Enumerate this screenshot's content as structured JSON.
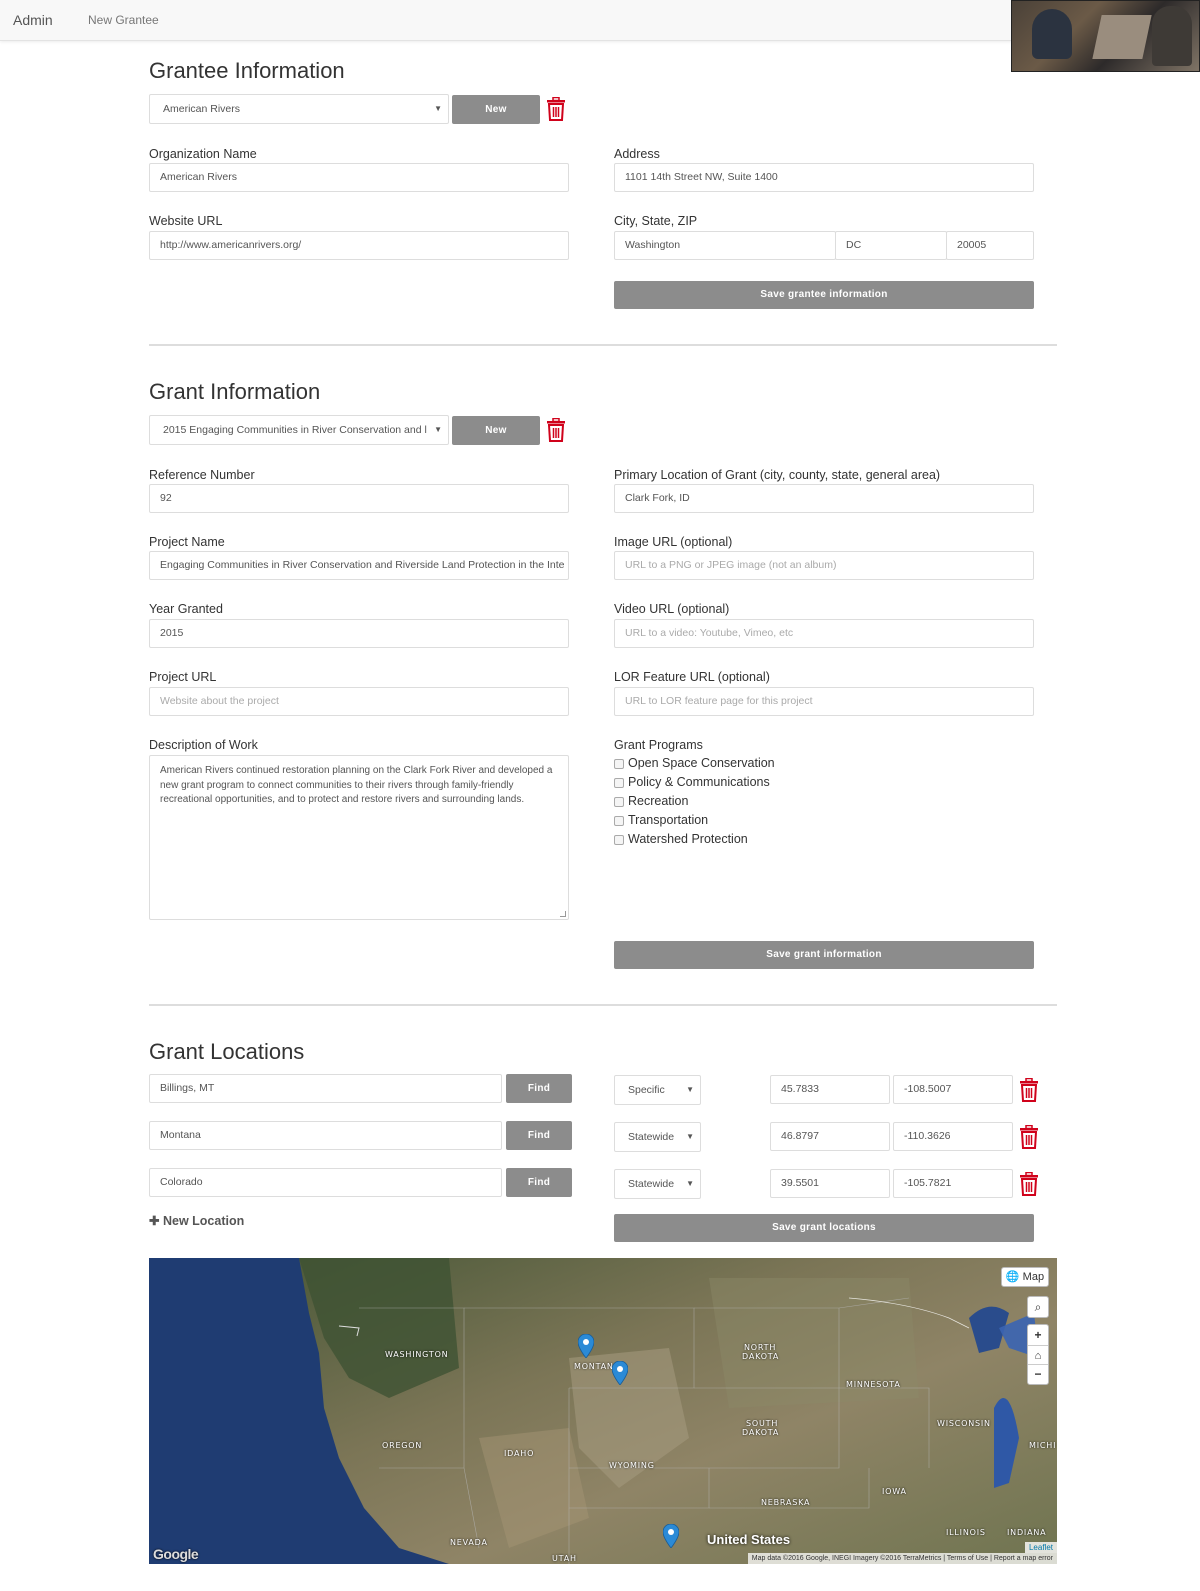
{
  "nav": {
    "brand": "Admin",
    "link": "New Grantee"
  },
  "grantee": {
    "heading": "Grantee Information",
    "select_value": "American Rivers",
    "new_label": "New",
    "org_label": "Organization Name",
    "org_value": "American Rivers",
    "address_label": "Address",
    "address_value": "1101 14th Street NW, Suite 1400",
    "website_label": "Website URL",
    "website_value": "http://www.americanrivers.org/",
    "csz_label": "City, State, ZIP",
    "city_value": "Washington",
    "state_value": "DC",
    "zip_value": "20005",
    "save_label": "Save grantee information"
  },
  "grant": {
    "heading": "Grant Information",
    "select_value": "2015 Engaging Communities in River Conservation and l",
    "new_label": "New",
    "ref_label": "Reference Number",
    "ref_value": "92",
    "primary_label": "Primary Location of Grant (city, county, state, general area)",
    "primary_value": "Clark Fork, ID",
    "project_name_label": "Project Name",
    "project_name_value": "Engaging Communities in River Conservation and Riverside Land Protection in the Inte",
    "image_label": "Image URL (optional)",
    "image_placeholder": "URL to a PNG or JPEG image (not an album)",
    "year_label": "Year Granted",
    "year_value": "2015",
    "video_label": "Video URL (optional)",
    "video_placeholder": "URL to a video: Youtube, Vimeo, etc",
    "project_url_label": "Project URL",
    "project_url_placeholder": "Website about the project",
    "lor_label": "LOR Feature URL (optional)",
    "lor_placeholder": "URL to LOR feature page for this project",
    "desc_label": "Description of Work",
    "desc_value": "American Rivers continued restoration planning on the Clark Fork River and developed a new grant program to connect communities to their rivers through family-friendly recreational opportunities, and to protect and restore rivers and surrounding lands.",
    "programs_label": "Grant Programs",
    "programs": [
      "Open Space Conservation",
      "Policy & Communications",
      "Recreation",
      "Transportation",
      "Watershed Protection"
    ],
    "save_label": "Save grant information"
  },
  "locations": {
    "heading": "Grant Locations",
    "find_label": "Find",
    "rows": [
      {
        "place": "Billings, MT",
        "scope": "Specific",
        "lat": "45.7833",
        "lng": "-108.5007"
      },
      {
        "place": "Montana",
        "scope": "Statewide",
        "lat": "46.8797",
        "lng": "-110.3626"
      },
      {
        "place": "Colorado",
        "scope": "Statewide",
        "lat": "39.5501",
        "lng": "-105.7821"
      }
    ],
    "new_location_label": "New Location",
    "save_label": "Save grant locations"
  },
  "map": {
    "layer_button": "Map",
    "labels": {
      "washington": "WASHINGTON",
      "montana": "MONTANA",
      "north_dakota_1": "NORTH",
      "north_dakota_2": "DAKOTA",
      "minnesota": "MINNESOTA",
      "south_dakota_1": "SOUTH",
      "south_dakota_2": "DAKOTA",
      "wisconsin": "WISCONSIN",
      "michigan": "MICHI",
      "oregon": "OREGON",
      "idaho": "IDAHO",
      "wyoming": "WYOMING",
      "nebraska": "NEBRASKA",
      "iowa": "IOWA",
      "illinois": "ILLINOIS",
      "indiana": "INDIANA",
      "nevada": "NEVADA",
      "utah": "UTAH",
      "united_states": "United States"
    },
    "attribution": "Map data ©2016 Google, INEGI Imagery ©2016 TerraMetrics | Terms of Use | Report a map error",
    "leaflet": "Leaflet",
    "google_logo": "Google"
  }
}
